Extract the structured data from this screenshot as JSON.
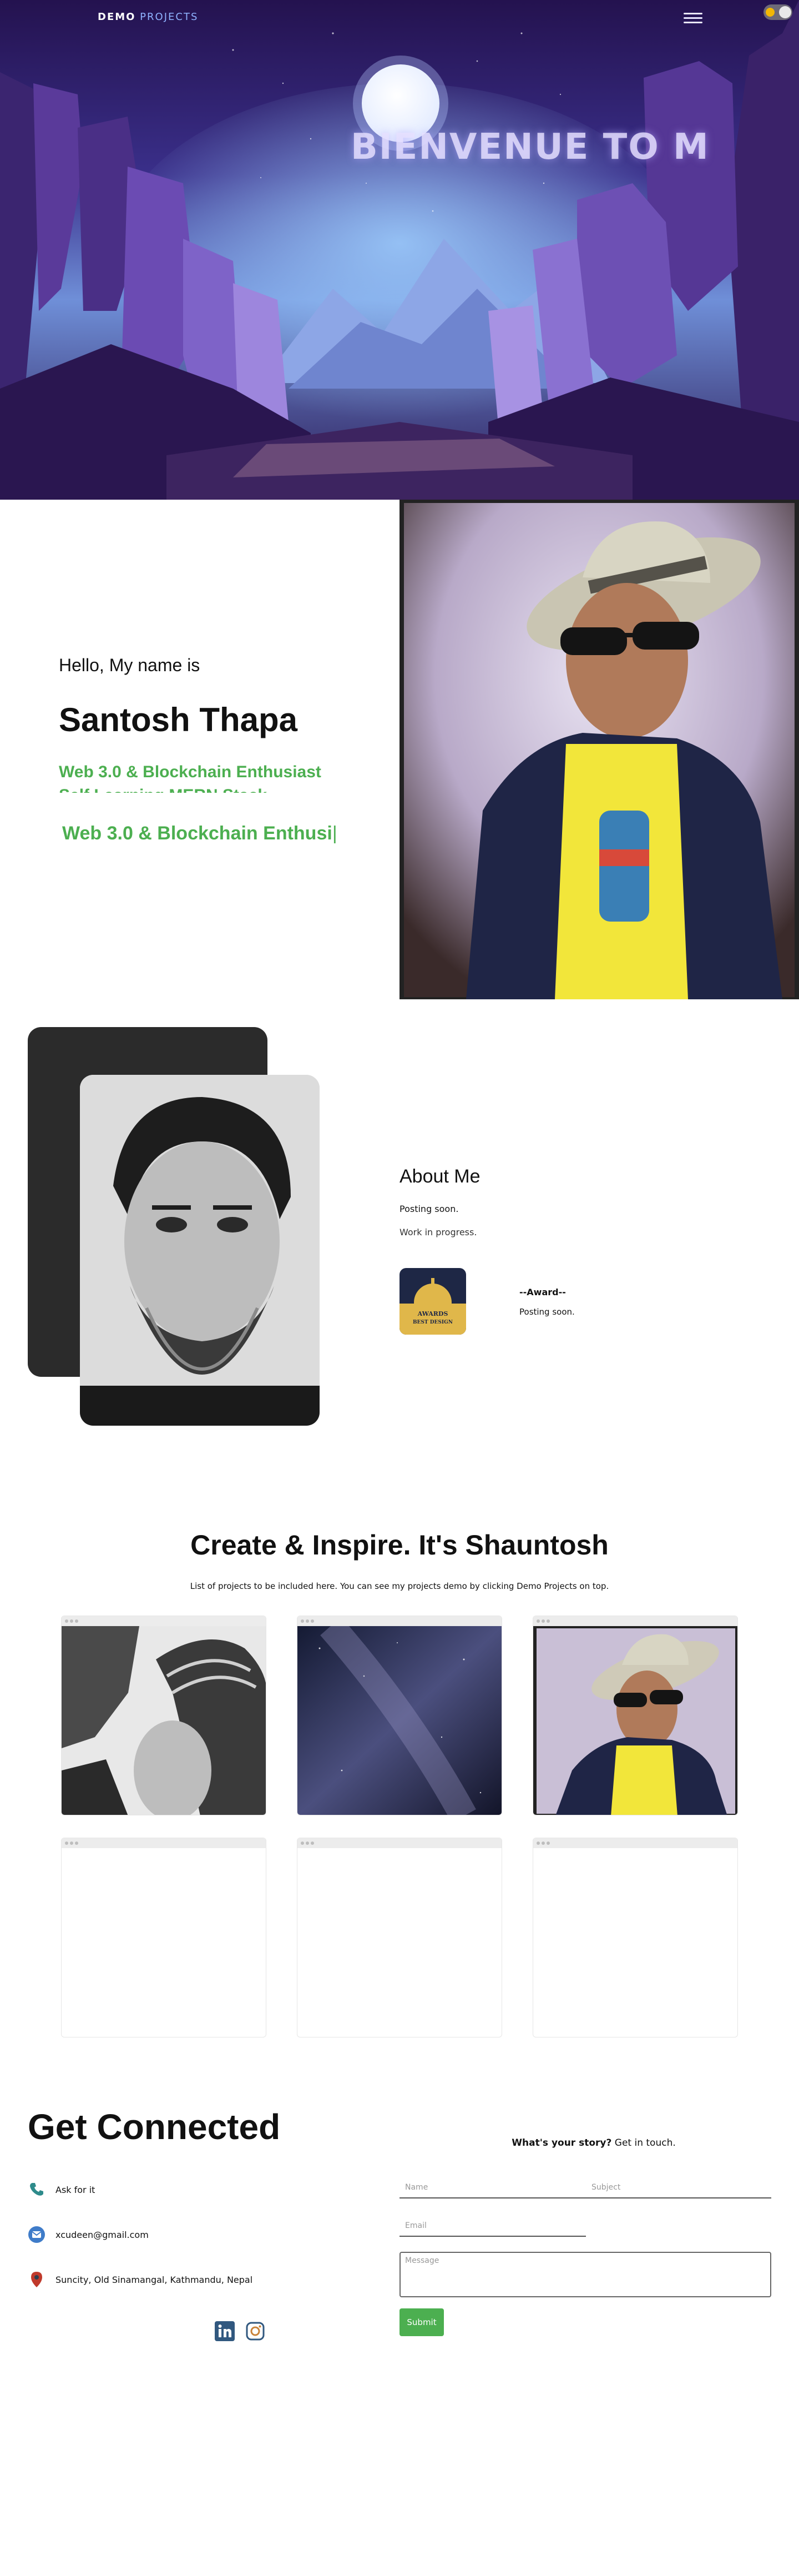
{
  "nav": {
    "brand_a": "DEMO",
    "brand_b": " PROJECTS"
  },
  "hero": {
    "title": "BIENVENUE TO M"
  },
  "intro": {
    "greeting": "Hello, My name is",
    "name": "Santosh Thapa",
    "rotating_lines": [
      "Web 3.0 & Blockchain Enthusiast",
      "Self Learning MERN Stack"
    ],
    "typed_text": "Web 3.0 & Blockchain Enthusi",
    "caret": "|"
  },
  "about": {
    "title": "About Me",
    "text1": "Posting soon.",
    "text2": "Work in progress.",
    "award_title": "--Award--",
    "award_text": "Posting soon.",
    "award_badge": {
      "line1": "AWARDS",
      "line2": "BEST DESIGN"
    }
  },
  "projects": {
    "title": "Create & Inspire. It's Shauntosh",
    "subtitle": "List of projects to be included here. You can see my projects demo by clicking Demo Projects on top."
  },
  "contact": {
    "title": "Get Connected",
    "items": [
      {
        "icon": "phone-icon",
        "text": "Ask for it"
      },
      {
        "icon": "email-icon",
        "text": "xcudeen@gmail.com"
      },
      {
        "icon": "location-pin-icon",
        "text": "Suncity, Old Sinamangal, Kathmandu, Nepal"
      }
    ],
    "social": [
      "linkedin-icon",
      "instagram-icon"
    ],
    "form": {
      "heading_bold": "What's your story?",
      "heading_rest": " Get in touch.",
      "name_placeholder": "Name",
      "subject_placeholder": "Subject",
      "email_placeholder": "Email",
      "message_placeholder": "Message",
      "submit_label": "Submit"
    }
  },
  "colors": {
    "accent_green": "#4caf50",
    "hero_purple": "#2a1a5e",
    "dark_card": "#2b2b2b"
  }
}
